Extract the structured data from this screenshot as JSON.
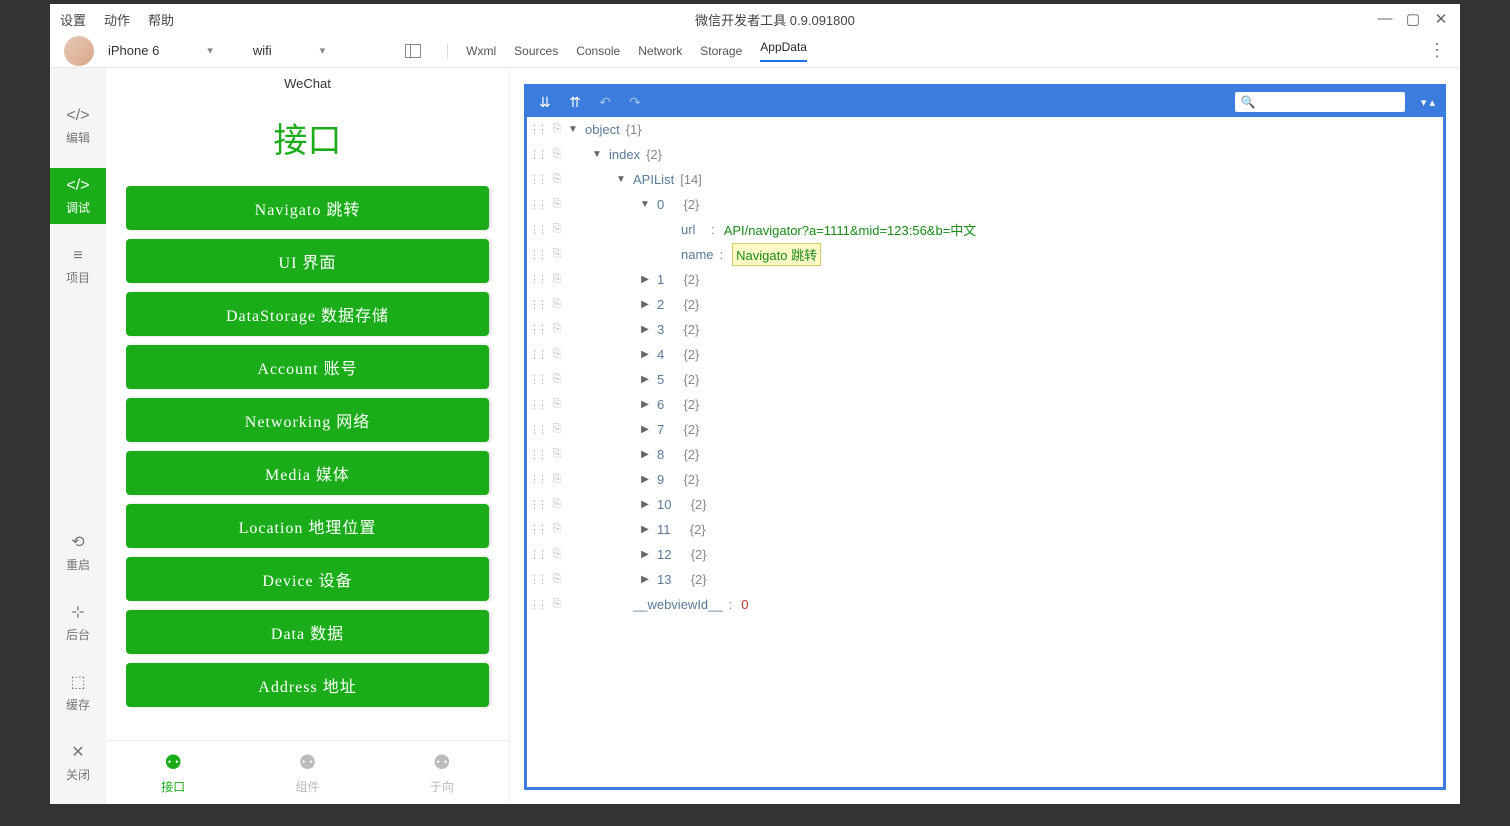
{
  "titlebar": {
    "menus": [
      "设置",
      "动作",
      "帮助"
    ],
    "title": "微信开发者工具 0.9.091800"
  },
  "toolbar": {
    "device": "iPhone 6",
    "network": "wifi",
    "devtabs": [
      "Wxml",
      "Sources",
      "Console",
      "Network",
      "Storage",
      "AppData"
    ],
    "active_tab": "AppData"
  },
  "leftnav": {
    "edit": "编辑",
    "debug": "调试",
    "project": "项目",
    "restart": "重启",
    "background": "后台",
    "cache": "缓存",
    "close": "关闭"
  },
  "simulator": {
    "header": "WeChat",
    "page_title": "接口",
    "buttons": [
      "Navigato 跳转",
      "UI 界面",
      "DataStorage 数据存储",
      "Account 账号",
      "Networking 网络",
      "Media 媒体",
      "Location 地理位置",
      "Device 设备",
      "Data 数据",
      "Address 地址"
    ],
    "bottom_tabs": [
      "接口",
      "组件",
      "于向"
    ]
  },
  "inspector": {
    "search_placeholder": "",
    "root_label": "object",
    "root_count": "{1}",
    "index_label": "index",
    "index_count": "{2}",
    "apilist_label": "APIList",
    "apilist_count": "[14]",
    "item0": {
      "idx": "0",
      "count": "{2}",
      "url_key": "url",
      "url_val": "API/navigator?a=1111&mid=123:56&b=中文",
      "name_key": "name",
      "name_val": "Navigato 跳转"
    },
    "rest": [
      {
        "idx": "1",
        "count": "{2}"
      },
      {
        "idx": "2",
        "count": "{2}"
      },
      {
        "idx": "3",
        "count": "{2}"
      },
      {
        "idx": "4",
        "count": "{2}"
      },
      {
        "idx": "5",
        "count": "{2}"
      },
      {
        "idx": "6",
        "count": "{2}"
      },
      {
        "idx": "7",
        "count": "{2}"
      },
      {
        "idx": "8",
        "count": "{2}"
      },
      {
        "idx": "9",
        "count": "{2}"
      },
      {
        "idx": "10",
        "count": "{2}"
      },
      {
        "idx": "11",
        "count": "{2}"
      },
      {
        "idx": "12",
        "count": "{2}"
      },
      {
        "idx": "13",
        "count": "{2}"
      }
    ],
    "webview_key": "__webviewId__",
    "webview_val": "0"
  }
}
